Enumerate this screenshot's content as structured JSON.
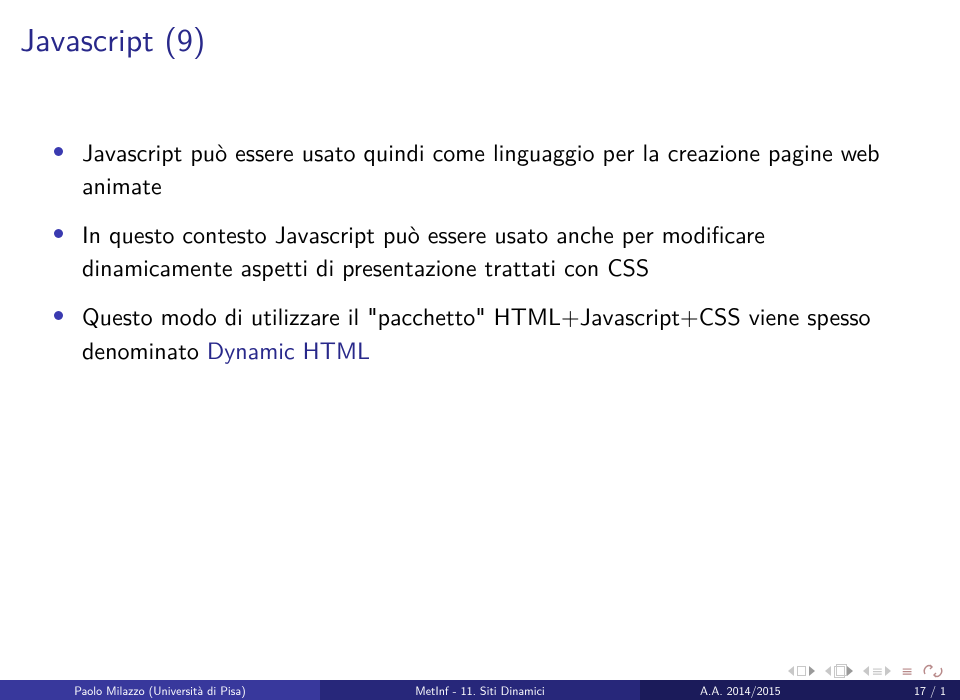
{
  "title": "Javascript (9)",
  "bullets": [
    {
      "segments": [
        {
          "text": "Javascript può essere usato quindi come linguaggio per la creazione pagine web animate",
          "accent": false
        }
      ]
    },
    {
      "segments": [
        {
          "text": "In questo contesto Javascript può essere usato anche per modificare dinamicamente aspetti di presentazione trattati con CSS",
          "accent": false
        }
      ]
    },
    {
      "segments": [
        {
          "text": "Questo modo di utilizzare il \"pacchetto\" HTML+Javascript+CSS viene spesso denominato ",
          "accent": false
        },
        {
          "text": "Dynamic HTML",
          "accent": true
        }
      ]
    }
  ],
  "footer": {
    "author": "Paolo Milazzo (Università di Pisa)",
    "short_title": "MetInf - 11. Siti Dinamici",
    "year": "A.A. 2014/2015",
    "page": "17 / 1"
  }
}
